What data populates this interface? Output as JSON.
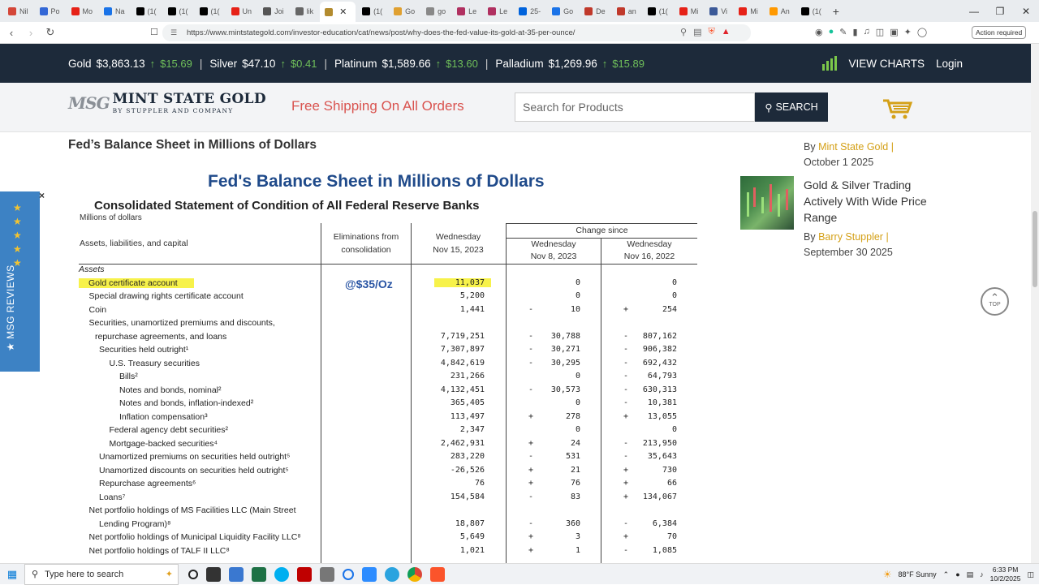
{
  "browser": {
    "tabs": [
      {
        "label": "Nil",
        "color": "#d44638"
      },
      {
        "label": "Po",
        "color": "#3367d6"
      },
      {
        "label": "Mo",
        "color": "#e62117"
      },
      {
        "label": "Na",
        "color": "#1a73e8"
      },
      {
        "label": "(1(",
        "color": "#000000"
      },
      {
        "label": "(1(",
        "color": "#000000"
      },
      {
        "label": "(1(",
        "color": "#000000"
      },
      {
        "label": "Un",
        "color": "#e62117"
      },
      {
        "label": "Joi",
        "color": "#555555"
      },
      {
        "label": "lik",
        "color": "#666666"
      },
      {
        "label": "",
        "color": "#b38b2e",
        "active": true
      },
      {
        "label": "(1(",
        "color": "#000000"
      },
      {
        "label": "Go",
        "color": "#e0a030"
      },
      {
        "label": "go",
        "color": "#888888"
      },
      {
        "label": "Le",
        "color": "#b03060"
      },
      {
        "label": "Le",
        "color": "#b03060"
      },
      {
        "label": "25-",
        "color": "#0063dc"
      },
      {
        "label": "Go",
        "color": "#1a73e8"
      },
      {
        "label": "De",
        "color": "#c0392b"
      },
      {
        "label": "an",
        "color": "#c0392b"
      },
      {
        "label": "(1(",
        "color": "#000000"
      },
      {
        "label": "Mi",
        "color": "#e62117"
      },
      {
        "label": "Vi",
        "color": "#3b5998"
      },
      {
        "label": "Mi",
        "color": "#e62117"
      },
      {
        "label": "An",
        "color": "#ff9900"
      },
      {
        "label": "(1(",
        "color": "#000000"
      }
    ],
    "new_tab": "+",
    "url": "https://www.mintstategold.com/investor-education/cat/news/post/why-does-the-fed-value-its-gold-at-35-per-ounce/",
    "action_required": "Action required"
  },
  "ticker": {
    "items": [
      {
        "name": "Gold",
        "price": "$3,863.13",
        "change": "$15.69"
      },
      {
        "name": "Silver",
        "price": "$47.10",
        "change": "$0.41"
      },
      {
        "name": "Platinum",
        "price": "$1,589.66",
        "change": "$13.60"
      },
      {
        "name": "Palladium",
        "price": "$1,269.96",
        "change": "$15.89"
      }
    ],
    "view_charts": "VIEW CHARTS",
    "login": "Login"
  },
  "header": {
    "logo_mark": "MSG",
    "logo_name": "MINT STATE GOLD",
    "logo_sub": "BY STUPPLER AND COMPANY",
    "shipping": "Free Shipping On All Orders",
    "search_placeholder": "Search for Products",
    "search_button": "SEARCH"
  },
  "article": {
    "section_title": "Fed’s Balance Sheet in Millions of Dollars",
    "doc_title": "Fed's Balance Sheet in Millions of Dollars",
    "doc_subtitle": "Consolidated Statement of Condition of All Federal Reserve Banks",
    "units": "Millions of dollars",
    "annotation": "@$35/Oz",
    "headers": {
      "col0": "Assets, liabilities, and capital",
      "col1a": "Eliminations from",
      "col1b": "consolidation",
      "col2a": "Wednesday",
      "col2b": "Nov 15, 2023",
      "change": "Change since",
      "col3a": "Wednesday",
      "col3b": "Nov 8, 2023",
      "col4a": "Wednesday",
      "col4b": "Nov 16, 2022"
    },
    "rows": [
      {
        "label": "Assets",
        "indent": 0,
        "italic": true,
        "v1": "",
        "s2": "",
        "v2": "",
        "s3": "",
        "v3": ""
      },
      {
        "label": "Gold certificate account",
        "indent": 1,
        "hl": true,
        "v1": "11,037",
        "s2": "",
        "v2": "0",
        "s3": "",
        "v3": "0"
      },
      {
        "label": "Special drawing rights certificate account",
        "indent": 1,
        "v1": "5,200",
        "s2": "",
        "v2": "0",
        "s3": "",
        "v3": "0"
      },
      {
        "label": "Coin",
        "indent": 1,
        "v1": "1,441",
        "s2": "-",
        "v2": "10",
        "s3": "+",
        "v3": "254"
      },
      {
        "label": "Securities, unamortized premiums and discounts,",
        "indent": 1,
        "v1": "",
        "s2": "",
        "v2": "",
        "s3": "",
        "v3": ""
      },
      {
        "label": "repurchase agreements, and loans",
        "indent": 1.6,
        "v1": "7,719,251",
        "s2": "-",
        "v2": "30,788",
        "s3": "-",
        "v3": "807,162"
      },
      {
        "label": "Securities held outright¹",
        "indent": 2,
        "v1": "7,307,897",
        "s2": "-",
        "v2": "30,271",
        "s3": "-",
        "v3": "906,382"
      },
      {
        "label": "U.S. Treasury securities",
        "indent": 3,
        "v1": "4,842,619",
        "s2": "-",
        "v2": "30,295",
        "s3": "-",
        "v3": "692,432"
      },
      {
        "label": "Bills²",
        "indent": 4,
        "v1": "231,266",
        "s2": "",
        "v2": "0",
        "s3": "-",
        "v3": "64,793"
      },
      {
        "label": "Notes and bonds, nominal²",
        "indent": 4,
        "v1": "4,132,451",
        "s2": "-",
        "v2": "30,573",
        "s3": "-",
        "v3": "630,313"
      },
      {
        "label": "Notes and bonds, inflation-indexed²",
        "indent": 4,
        "v1": "365,405",
        "s2": "",
        "v2": "0",
        "s3": "-",
        "v3": "10,381"
      },
      {
        "label": "Inflation compensation³",
        "indent": 4,
        "v1": "113,497",
        "s2": "+",
        "v2": "278",
        "s3": "+",
        "v3": "13,055"
      },
      {
        "label": "Federal agency debt securities²",
        "indent": 3,
        "v1": "2,347",
        "s2": "",
        "v2": "0",
        "s3": "",
        "v3": "0"
      },
      {
        "label": "Mortgage-backed securities⁴",
        "indent": 3,
        "v1": "2,462,931",
        "s2": "+",
        "v2": "24",
        "s3": "-",
        "v3": "213,950"
      },
      {
        "label": "Unamortized premiums on securities held outright⁵",
        "indent": 2,
        "v1": "283,220",
        "s2": "-",
        "v2": "531",
        "s3": "-",
        "v3": "35,643"
      },
      {
        "label": "Unamortized discounts on securities held outright⁵",
        "indent": 2,
        "v1": "-26,526",
        "s2": "+",
        "v2": "21",
        "s3": "+",
        "v3": "730"
      },
      {
        "label": "Repurchase agreements⁶",
        "indent": 2,
        "v1": "76",
        "s2": "+",
        "v2": "76",
        "s3": "+",
        "v3": "66"
      },
      {
        "label": "Loans⁷",
        "indent": 2,
        "v1": "154,584",
        "s2": "-",
        "v2": "83",
        "s3": "+",
        "v3": "134,067"
      },
      {
        "label": "Net portfolio holdings of MS Facilities LLC (Main Street",
        "indent": 1,
        "v1": "",
        "s2": "",
        "v2": "",
        "s3": "",
        "v3": ""
      },
      {
        "label": "Lending Program)⁸",
        "indent": 2,
        "v1": "18,807",
        "s2": "-",
        "v2": "360",
        "s3": "-",
        "v3": "6,384"
      },
      {
        "label": "Net portfolio holdings of Municipal Liquidity Facility LLC⁸",
        "indent": 1,
        "v1": "5,649",
        "s2": "+",
        "v2": "3",
        "s3": "+",
        "v3": "70"
      },
      {
        "label": "Net portfolio holdings of TALF II LLC⁸",
        "indent": 1,
        "v1": "1,021",
        "s2": "+",
        "v2": "1",
        "s3": "-",
        "v3": "1,085"
      }
    ]
  },
  "sidebar": {
    "post1_by": "By",
    "post1_author": "Mint State Gold",
    "post1_date": "October 1 2025",
    "post2_title": "Gold & Silver Trading Actively With Wide Price Range",
    "post2_by": "By",
    "post2_author": "Barry Stuppler",
    "post2_date": "September 30 2025"
  },
  "top_button": "TOP",
  "reviews": {
    "label": "★ MSG REVIEWS",
    "close": "×"
  },
  "taskbar": {
    "search_placeholder": "Type here to search",
    "weather": "88°F  Sunny",
    "time": "6:33 PM",
    "date": "10/2/2025"
  }
}
